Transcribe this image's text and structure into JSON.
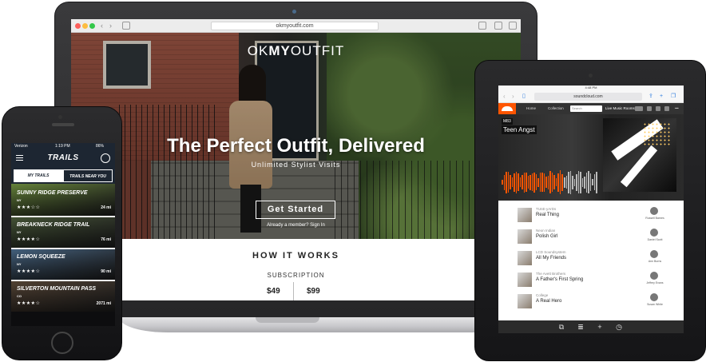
{
  "laptop": {
    "url": "okmyoutfit.com",
    "logo_light": "OK",
    "logo_bold": "MY",
    "logo_rest": "OUTFIT",
    "hero_title": "The Perfect Outfit, Delivered",
    "hero_subtitle": "Unlimited Stylist Visits",
    "cta_label": "Get Started",
    "signin_text": "Already a member? Sign In",
    "how_title": "HOW IT WORKS",
    "how_subtitle": "SUBSCRIPTION",
    "prices": [
      "$49",
      "$99"
    ]
  },
  "phone": {
    "carrier": "Verizon",
    "time": "1:19 PM",
    "battery": "86%",
    "title": "TRAILS",
    "tabs": [
      "MY TRAILS",
      "TRAILS NEAR YOU"
    ],
    "trails": [
      {
        "name": "SUNNY RIDGE PRESERVE",
        "state": "NY",
        "stars": "★★★☆☆",
        "distance": "24 mi",
        "bg": "#6b8a3d"
      },
      {
        "name": "BREAKNECK RIDGE TRAIL",
        "state": "NY",
        "stars": "★★★★☆",
        "distance": "76 mi",
        "bg": "#4a5a3a"
      },
      {
        "name": "LEMON SQUEEZE",
        "state": "NY",
        "stars": "★★★★☆",
        "distance": "90 mi",
        "bg": "#4a6a8a"
      },
      {
        "name": "SILVERTON MOUNTAIN PASS",
        "state": "CO",
        "stars": "★★★★☆",
        "distance": "2071 mi",
        "bg": "#5a4838"
      }
    ]
  },
  "tablet": {
    "time": "4:48 PM",
    "url": "soundcloud.com",
    "nav": {
      "home": "Home",
      "collection": "Collection",
      "search_placeholder": "Search",
      "promo": "Live Music Rooms"
    },
    "hero_artist": "M83",
    "hero_track": "Teen Angst",
    "tracks": [
      {
        "artist": "TUnE-yArDs",
        "title": "Real Thing",
        "user": "Russell Barnes"
      },
      {
        "artist": "Neon Indian",
        "title": "Polish Girl",
        "user": "Daniel Scott"
      },
      {
        "artist": "LCD Soundsystem",
        "title": "All My Friends",
        "user": "Ann Burns"
      },
      {
        "artist": "The Avett Brothers",
        "title": "A Father's First Spring",
        "user": "Jeffrey Evans"
      },
      {
        "artist": "College",
        "title": "A Real Hero",
        "user": "Susan White"
      }
    ],
    "accent_color": "#ff5500"
  }
}
